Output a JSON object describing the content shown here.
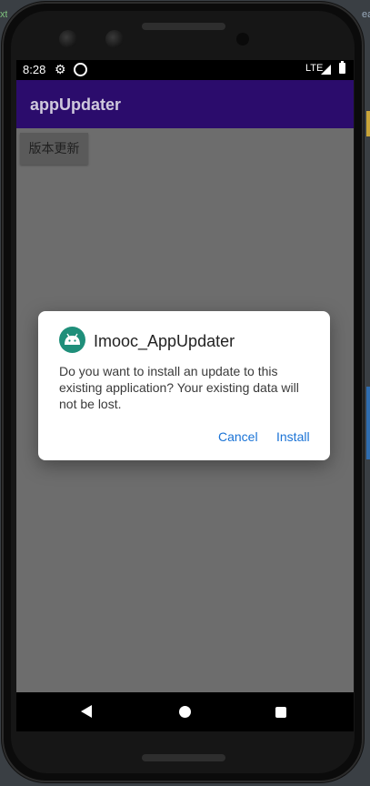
{
  "status_bar": {
    "time": "8:28",
    "network": "LTE"
  },
  "app_bar": {
    "title": "appUpdater"
  },
  "main": {
    "version_button_label": "版本更新"
  },
  "dialog": {
    "title": "Imooc_AppUpdater",
    "message": "Do you want to install an update to this existing application? Your existing data will not be lost.",
    "cancel_label": "Cancel",
    "install_label": "Install",
    "accent_color": "#1a73d6",
    "icon_color": "#1f8f7a"
  },
  "ide_edges": {
    "left_text": "xt",
    "right_text": "ea"
  },
  "colors": {
    "app_bar": "#2b0c6c",
    "screen_scrim": "#6d6d6d"
  }
}
